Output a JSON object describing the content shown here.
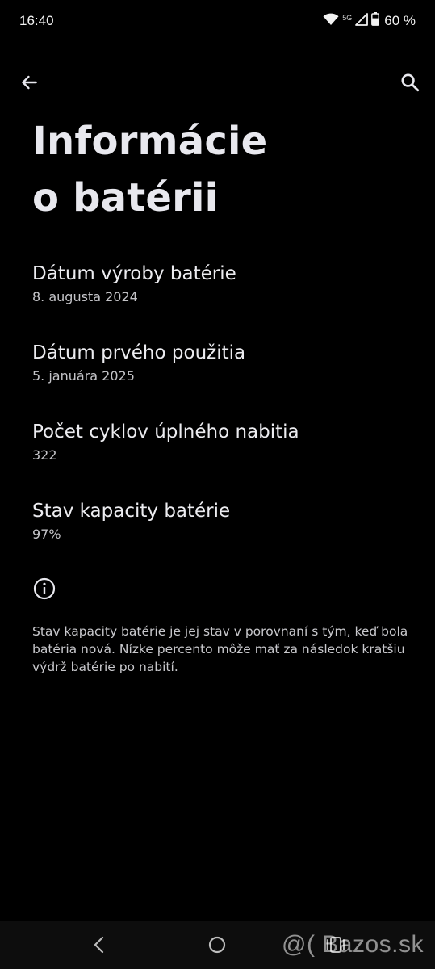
{
  "status_bar": {
    "time": "16:40",
    "network": "5G",
    "battery": "60 %",
    "icons": [
      "wifi-icon",
      "signal-icon",
      "battery-icon"
    ]
  },
  "toolbar": {
    "back_icon": "arrow-left-icon",
    "search_icon": "search-icon"
  },
  "page": {
    "title_line1": "Informácie",
    "title_line2": "o batérii"
  },
  "items": [
    {
      "title": "Dátum výroby batérie",
      "value": "8. augusta 2024"
    },
    {
      "title": "Dátum prvého použitia",
      "value": "5. januára 2025"
    },
    {
      "title": "Počet cyklov úplného nabitia",
      "value": "322"
    },
    {
      "title": "Stav kapacity batérie",
      "value": "97%"
    }
  ],
  "footer": {
    "info_icon": "info-icon",
    "text": "Stav kapacity batérie je jej stav v porovnaní s tým, keď bola batéria nová. Nízke percento môže mať za následok kratšiu výdrž batérie po nabití."
  },
  "nav_bar": {
    "icons": [
      "nav-back-icon",
      "nav-home-icon",
      "nav-recents-icon"
    ]
  },
  "watermark": "@( Bazos.sk",
  "colors": {
    "background": "#000000",
    "text_primary": "#ececf0",
    "text_secondary": "#c4c4c8",
    "nav_bar": "#0d0d0d"
  }
}
